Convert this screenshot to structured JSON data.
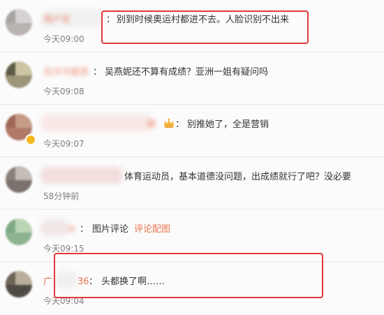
{
  "comments": [
    {
      "id": "c1",
      "username": "用户名",
      "separator": "：",
      "content": "别到时候奥运村都进不去。人脸识别不出来",
      "time": "今天09:00",
      "highlighted": true
    },
    {
      "id": "c2",
      "username": "北冷冷姐员",
      "separator": "：",
      "content": "吴燕妮还不算有成绩？亚洲一姐有疑问吗",
      "time": "今天09:08",
      "highlighted": false
    },
    {
      "id": "c3",
      "username": "锁",
      "separator": "：",
      "content": "别推她了，全是营销",
      "time": "今天09:07",
      "highlighted": false,
      "has_crown_icon": true,
      "has_verified_badge": true
    },
    {
      "id": "c4",
      "username": "",
      "separator": "",
      "content": "体育运动员，基本道德没问题，出成绩就行了吧？没必要",
      "time": "58分钟前",
      "highlighted": false
    },
    {
      "id": "c5",
      "username": "火",
      "separator": "：",
      "content": "图片评论",
      "link_text": "评论配图",
      "time": "今天09:15",
      "highlighted": false
    },
    {
      "id": "c6",
      "username": "广",
      "username_suffix": "36",
      "separator": "：",
      "content": "头都换了啊……",
      "time": "今天09:04",
      "highlighted": true
    }
  ],
  "colors": {
    "username": "#eb7350",
    "highlight_border": "#e33a3a",
    "timestamp": "#808080",
    "text": "#333333",
    "badge": "#f6b91f"
  }
}
